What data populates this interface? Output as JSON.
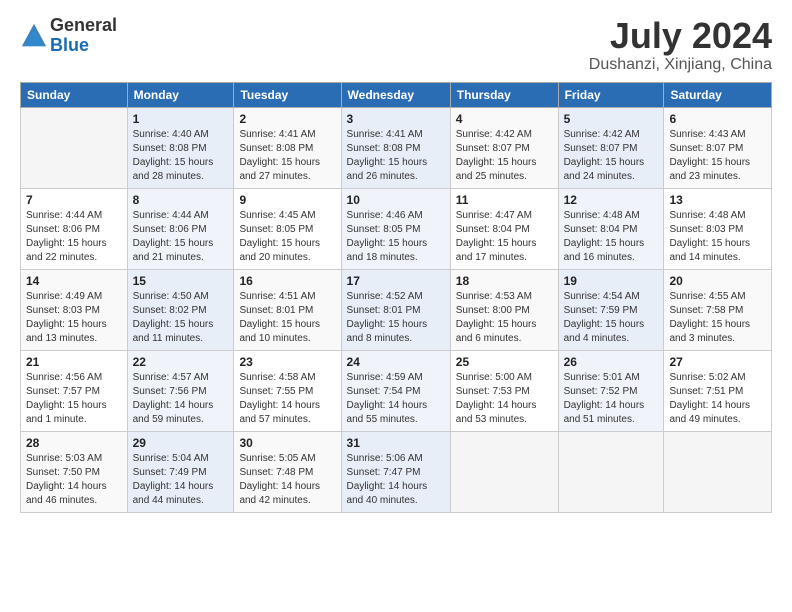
{
  "logo": {
    "general": "General",
    "blue": "Blue"
  },
  "title": "July 2024",
  "subtitle": "Dushanzi, Xinjiang, China",
  "days_of_week": [
    "Sunday",
    "Monday",
    "Tuesday",
    "Wednesday",
    "Thursday",
    "Friday",
    "Saturday"
  ],
  "weeks": [
    [
      {
        "day": "",
        "info": ""
      },
      {
        "day": "1",
        "info": "Sunrise: 4:40 AM\nSunset: 8:08 PM\nDaylight: 15 hours\nand 28 minutes."
      },
      {
        "day": "2",
        "info": "Sunrise: 4:41 AM\nSunset: 8:08 PM\nDaylight: 15 hours\nand 27 minutes."
      },
      {
        "day": "3",
        "info": "Sunrise: 4:41 AM\nSunset: 8:08 PM\nDaylight: 15 hours\nand 26 minutes."
      },
      {
        "day": "4",
        "info": "Sunrise: 4:42 AM\nSunset: 8:07 PM\nDaylight: 15 hours\nand 25 minutes."
      },
      {
        "day": "5",
        "info": "Sunrise: 4:42 AM\nSunset: 8:07 PM\nDaylight: 15 hours\nand 24 minutes."
      },
      {
        "day": "6",
        "info": "Sunrise: 4:43 AM\nSunset: 8:07 PM\nDaylight: 15 hours\nand 23 minutes."
      }
    ],
    [
      {
        "day": "7",
        "info": "Sunrise: 4:44 AM\nSunset: 8:06 PM\nDaylight: 15 hours\nand 22 minutes."
      },
      {
        "day": "8",
        "info": "Sunrise: 4:44 AM\nSunset: 8:06 PM\nDaylight: 15 hours\nand 21 minutes."
      },
      {
        "day": "9",
        "info": "Sunrise: 4:45 AM\nSunset: 8:05 PM\nDaylight: 15 hours\nand 20 minutes."
      },
      {
        "day": "10",
        "info": "Sunrise: 4:46 AM\nSunset: 8:05 PM\nDaylight: 15 hours\nand 18 minutes."
      },
      {
        "day": "11",
        "info": "Sunrise: 4:47 AM\nSunset: 8:04 PM\nDaylight: 15 hours\nand 17 minutes."
      },
      {
        "day": "12",
        "info": "Sunrise: 4:48 AM\nSunset: 8:04 PM\nDaylight: 15 hours\nand 16 minutes."
      },
      {
        "day": "13",
        "info": "Sunrise: 4:48 AM\nSunset: 8:03 PM\nDaylight: 15 hours\nand 14 minutes."
      }
    ],
    [
      {
        "day": "14",
        "info": "Sunrise: 4:49 AM\nSunset: 8:03 PM\nDaylight: 15 hours\nand 13 minutes."
      },
      {
        "day": "15",
        "info": "Sunrise: 4:50 AM\nSunset: 8:02 PM\nDaylight: 15 hours\nand 11 minutes."
      },
      {
        "day": "16",
        "info": "Sunrise: 4:51 AM\nSunset: 8:01 PM\nDaylight: 15 hours\nand 10 minutes."
      },
      {
        "day": "17",
        "info": "Sunrise: 4:52 AM\nSunset: 8:01 PM\nDaylight: 15 hours\nand 8 minutes."
      },
      {
        "day": "18",
        "info": "Sunrise: 4:53 AM\nSunset: 8:00 PM\nDaylight: 15 hours\nand 6 minutes."
      },
      {
        "day": "19",
        "info": "Sunrise: 4:54 AM\nSunset: 7:59 PM\nDaylight: 15 hours\nand 4 minutes."
      },
      {
        "day": "20",
        "info": "Sunrise: 4:55 AM\nSunset: 7:58 PM\nDaylight: 15 hours\nand 3 minutes."
      }
    ],
    [
      {
        "day": "21",
        "info": "Sunrise: 4:56 AM\nSunset: 7:57 PM\nDaylight: 15 hours\nand 1 minute."
      },
      {
        "day": "22",
        "info": "Sunrise: 4:57 AM\nSunset: 7:56 PM\nDaylight: 14 hours\nand 59 minutes."
      },
      {
        "day": "23",
        "info": "Sunrise: 4:58 AM\nSunset: 7:55 PM\nDaylight: 14 hours\nand 57 minutes."
      },
      {
        "day": "24",
        "info": "Sunrise: 4:59 AM\nSunset: 7:54 PM\nDaylight: 14 hours\nand 55 minutes."
      },
      {
        "day": "25",
        "info": "Sunrise: 5:00 AM\nSunset: 7:53 PM\nDaylight: 14 hours\nand 53 minutes."
      },
      {
        "day": "26",
        "info": "Sunrise: 5:01 AM\nSunset: 7:52 PM\nDaylight: 14 hours\nand 51 minutes."
      },
      {
        "day": "27",
        "info": "Sunrise: 5:02 AM\nSunset: 7:51 PM\nDaylight: 14 hours\nand 49 minutes."
      }
    ],
    [
      {
        "day": "28",
        "info": "Sunrise: 5:03 AM\nSunset: 7:50 PM\nDaylight: 14 hours\nand 46 minutes."
      },
      {
        "day": "29",
        "info": "Sunrise: 5:04 AM\nSunset: 7:49 PM\nDaylight: 14 hours\nand 44 minutes."
      },
      {
        "day": "30",
        "info": "Sunrise: 5:05 AM\nSunset: 7:48 PM\nDaylight: 14 hours\nand 42 minutes."
      },
      {
        "day": "31",
        "info": "Sunrise: 5:06 AM\nSunset: 7:47 PM\nDaylight: 14 hours\nand 40 minutes."
      },
      {
        "day": "",
        "info": ""
      },
      {
        "day": "",
        "info": ""
      },
      {
        "day": "",
        "info": ""
      }
    ]
  ]
}
